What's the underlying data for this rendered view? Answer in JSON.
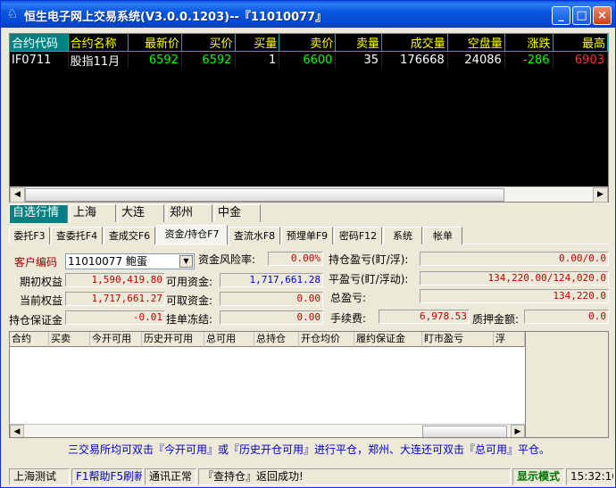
{
  "window": {
    "title": "恒生电子网上交易系统(V3.0.0.1203)--『11010077』",
    "minimize": "_",
    "maximize": "□",
    "close": "×"
  },
  "quote_table": {
    "columns": [
      "合约代码",
      "合约名称",
      "最新价",
      "买价",
      "买量",
      "卖价",
      "卖量",
      "成交量",
      "空盘量",
      "涨跌",
      "最高"
    ],
    "rows": [
      {
        "code": "IF0711",
        "name": "股指11月",
        "last": "6592",
        "bid": "6592",
        "bid_vol": "1",
        "ask": "6600",
        "ask_vol": "35",
        "volume": "176668",
        "open_int": "24086",
        "change": "-286",
        "high": "6903"
      }
    ]
  },
  "exchange_tabs": [
    "自选行情",
    "上海",
    "大连",
    "郑州",
    "中金"
  ],
  "function_tabs": [
    "委托F3",
    "查委托F4",
    "查成交F6",
    "资金/持仓F7",
    "查流水F8",
    "预埋单F9",
    "密码F12",
    "系统",
    "帐单"
  ],
  "account": {
    "client_code_label": "客户编码",
    "client_code_value": "11010077 鲍蛋",
    "risk_label": "资金风险率:",
    "risk_value": "0.00%",
    "opening_equity_label": "期初权益",
    "opening_equity_value": "1,590,419.80",
    "available_label": "可用资金:",
    "available_value": "1,717,661.28",
    "current_equity_label": "当前权益",
    "current_equity_value": "1,717,661.27",
    "withdrawable_label": "可取资金:",
    "withdrawable_value": "0.00",
    "margin_label": "持仓保证金",
    "margin_value": "-0.01",
    "frozen_label": "挂单冻结:",
    "frozen_value": "0.00",
    "pos_pnl_label": "持仓盈亏(盯/浮):",
    "pos_pnl_value": "0.00/0.0",
    "close_pnl_label": "平盈亏(盯/浮动):",
    "close_pnl_value": "134,220.00/124,020.0",
    "total_pnl_label": "总盈亏:",
    "total_pnl_value": "134,220.0",
    "fee_label": "手续费:",
    "fee_value": "6,978.53",
    "pledge_label": "质押金额:",
    "pledge_value": "0.0"
  },
  "positions": {
    "columns": [
      "合约",
      "买卖",
      "今开可用",
      "历史开可用",
      "总可用",
      "总持仓",
      "开仓均价",
      "履约保证金",
      "盯市盈亏",
      "浮"
    ]
  },
  "hint": "三交易所均可双击『今开可用』或『历史开仓可用』进行平仓，郑州、大连还可双击『总可用』平仓。",
  "status": {
    "server": "上海测试",
    "help": "F1帮助F5刷新",
    "comm": "通讯正常",
    "message": "『查持仓』返回成功!",
    "mode": "显示模式",
    "time": "15:32:16"
  }
}
